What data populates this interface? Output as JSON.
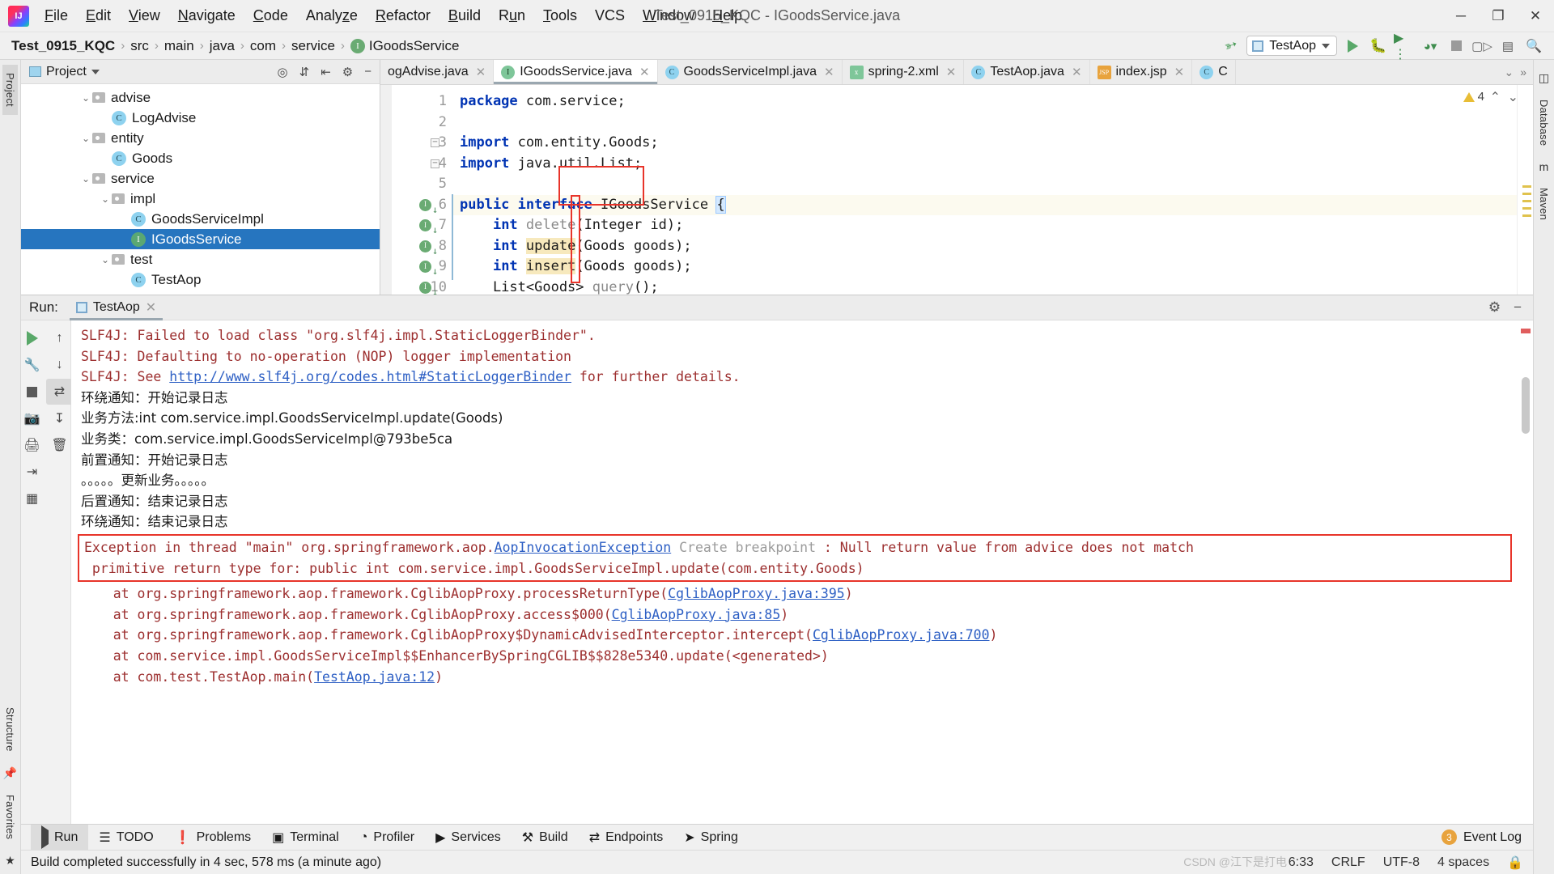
{
  "window": {
    "title": "Test_0915_KQC - IGoodsService.java",
    "minimize": "─",
    "maximize": "❐",
    "close": "✕"
  },
  "menu": [
    {
      "label": "File"
    },
    {
      "label": "Edit"
    },
    {
      "label": "View"
    },
    {
      "label": "Navigate"
    },
    {
      "label": "Code"
    },
    {
      "label": "Analyze"
    },
    {
      "label": "Refactor"
    },
    {
      "label": "Build"
    },
    {
      "label": "Run"
    },
    {
      "label": "Tools"
    },
    {
      "label": "VCS"
    },
    {
      "label": "Window"
    },
    {
      "label": "Help"
    }
  ],
  "breadcrumb": {
    "items": [
      "Test_0915_KQC",
      "src",
      "main",
      "java",
      "com",
      "service",
      "IGoodsService"
    ],
    "leaf_icon": "I",
    "separator": "›"
  },
  "toolbar": {
    "build_icon": "build-hammer-icon",
    "run_config": "TestAop",
    "run_label": "run-icon",
    "debug_label": "debug-icon",
    "coverage_label": "run-with-coverage-icon",
    "profiler_label": "profiler-icon",
    "stop_label": "stop-icon",
    "search_label": "search-icon"
  },
  "left_rail": [
    "Project",
    "Structure",
    "Favorites"
  ],
  "right_rail": [
    "Database",
    "Maven"
  ],
  "project_panel": {
    "title": "Project",
    "tools": [
      "locate-icon",
      "expand-all-icon",
      "collapse-all-icon",
      "settings-icon",
      "hide-icon"
    ],
    "tree": [
      {
        "label": "advise",
        "type": "folder",
        "indent": 3,
        "expanded": true
      },
      {
        "label": "LogAdvise",
        "type": "class",
        "indent": 4
      },
      {
        "label": "entity",
        "type": "folder",
        "indent": 3,
        "expanded": true
      },
      {
        "label": "Goods",
        "type": "class",
        "indent": 4
      },
      {
        "label": "service",
        "type": "folder",
        "indent": 3,
        "expanded": true
      },
      {
        "label": "impl",
        "type": "folder",
        "indent": 4,
        "expanded": true
      },
      {
        "label": "GoodsServiceImpl",
        "type": "class",
        "indent": 5
      },
      {
        "label": "IGoodsService",
        "type": "interface",
        "indent": 5,
        "selected": true
      },
      {
        "label": "test",
        "type": "folder",
        "indent": 4,
        "expanded": true
      },
      {
        "label": "TestAop",
        "type": "class",
        "indent": 5
      }
    ]
  },
  "editor": {
    "tabs": [
      {
        "label": "ogAdvise.java",
        "icon": "",
        "active": false,
        "closable": true
      },
      {
        "label": "IGoodsService.java",
        "icon": "I",
        "icon_kind": "green",
        "active": true,
        "closable": true
      },
      {
        "label": "GoodsServiceImpl.java",
        "icon": "C",
        "icon_kind": "blue",
        "active": false,
        "closable": true
      },
      {
        "label": "spring-2.xml",
        "icon": "x",
        "icon_kind": "xml",
        "active": false,
        "closable": true
      },
      {
        "label": "TestAop.java",
        "icon": "C",
        "icon_kind": "blue",
        "active": false,
        "closable": true
      },
      {
        "label": "index.jsp",
        "icon": "JSP",
        "icon_kind": "jsp",
        "active": false,
        "closable": true
      },
      {
        "label": "C",
        "icon": "C",
        "icon_kind": "blue",
        "active": false,
        "closable": false
      }
    ],
    "warning_count": "4",
    "lines": [
      {
        "n": "1",
        "segs": [
          {
            "t": "package ",
            "c": "kw"
          },
          {
            "t": "com.service;",
            "c": "pl"
          }
        ]
      },
      {
        "n": "2",
        "segs": []
      },
      {
        "n": "3",
        "fold": true,
        "segs": [
          {
            "t": "import ",
            "c": "kw"
          },
          {
            "t": "com.entity.Goods;",
            "c": "pl"
          }
        ]
      },
      {
        "n": "4",
        "fold": true,
        "segs": [
          {
            "t": "import ",
            "c": "kw"
          },
          {
            "t": "java.util.List;",
            "c": "pl"
          }
        ]
      },
      {
        "n": "5",
        "segs": []
      },
      {
        "n": "6",
        "marker": true,
        "hl": true,
        "segs": [
          {
            "t": "public ",
            "c": "kw"
          },
          {
            "t": "interface ",
            "c": "kw"
          },
          {
            "t": "IGoodsService ",
            "c": "pl"
          },
          {
            "t": "{",
            "c": "brace"
          }
        ]
      },
      {
        "n": "7",
        "marker": true,
        "segs": [
          {
            "t": "    ",
            "c": "pl"
          },
          {
            "t": "int ",
            "c": "kw"
          },
          {
            "t": "delete",
            "c": "mth"
          },
          {
            "t": "(Integer id);",
            "c": "pl"
          }
        ]
      },
      {
        "n": "8",
        "marker": true,
        "segs": [
          {
            "t": "    ",
            "c": "pl"
          },
          {
            "t": "int ",
            "c": "kw"
          },
          {
            "t": "update",
            "c": "hlident"
          },
          {
            "t": "(Goods goods);",
            "c": "pl"
          }
        ]
      },
      {
        "n": "9",
        "marker": true,
        "segs": [
          {
            "t": "    ",
            "c": "pl"
          },
          {
            "t": "int ",
            "c": "kw"
          },
          {
            "t": "insert",
            "c": "hlident"
          },
          {
            "t": "(Goods goods);",
            "c": "pl"
          }
        ]
      },
      {
        "n": "10",
        "marker": true,
        "segs": [
          {
            "t": "    List<Goods> ",
            "c": "pl"
          },
          {
            "t": "query",
            "c": "mth"
          },
          {
            "t": "();",
            "c": "pl"
          }
        ]
      }
    ]
  },
  "run_panel": {
    "label": "Run:",
    "tab": "TestAop",
    "close": "✕",
    "settings_icon": "gear-icon",
    "minimize_icon": "minimize-icon",
    "sidebar_buttons": [
      "rerun-icon",
      "up-stack-icon",
      "wrench-icon",
      "down-stack-icon",
      "stop-icon",
      "soft-wrap-icon",
      "camera-icon",
      "scroll-to-end-icon",
      "print-icon",
      "clear-all-icon",
      "trash-icon",
      "export-icon",
      "layout-icon",
      "pin-icon"
    ],
    "console": [
      {
        "kind": "err",
        "text": "SLF4J: Failed to load class \"org.slf4j.impl.StaticLoggerBinder\"."
      },
      {
        "kind": "err",
        "text": "SLF4J: Defaulting to no-operation (NOP) logger implementation"
      },
      {
        "kind": "err-link",
        "pre": "SLF4J: See ",
        "link": "http://www.slf4j.org/codes.html#StaticLoggerBinder",
        "post": " for further details."
      },
      {
        "kind": "cn",
        "text": "环绕通知：开始记录日志"
      },
      {
        "kind": "cn",
        "text": "业务方法:int com.service.impl.GoodsServiceImpl.update(Goods)"
      },
      {
        "kind": "cn",
        "text": "业务类：com.service.impl.GoodsServiceImpl@793be5ca"
      },
      {
        "kind": "cn",
        "text": "前置通知：开始记录日志"
      },
      {
        "kind": "cn",
        "text": "。。。。。更新业务。。。。。"
      },
      {
        "kind": "cn",
        "text": "后置通知：结束记录日志"
      },
      {
        "kind": "cn",
        "text": "环绕通知：结束记录日志"
      }
    ],
    "exception": {
      "line1_pre": "Exception in thread \"main\" org.springframework.aop.",
      "line1_link": "AopInvocationException",
      "line1_breakpoint": " Create breakpoint",
      "line1_post": " : Null return value from advice does not match",
      "line2": " primitive return type for: public int com.service.impl.GoodsServiceImpl.update(com.entity.Goods)"
    },
    "stack": [
      {
        "pre": "    at org.springframework.aop.framework.CglibAopProxy.processReturnType(",
        "link": "CglibAopProxy.java:395",
        "post": ")"
      },
      {
        "pre": "    at org.springframework.aop.framework.CglibAopProxy.access$000(",
        "link": "CglibAopProxy.java:85",
        "post": ")"
      },
      {
        "pre": "    at org.springframework.aop.framework.CglibAopProxy$DynamicAdvisedInterceptor.intercept(",
        "link": "CglibAopProxy.java:700",
        "post": ")"
      },
      {
        "pre": "    at com.service.impl.GoodsServiceImpl$$EnhancerBySpringCGLIB$$828e5340.update(<generated>)",
        "link": "",
        "post": ""
      },
      {
        "pre": "    at com.test.TestAop.main(",
        "link": "TestAop.java:12",
        "post": ")"
      }
    ]
  },
  "toolwindow_bar": {
    "items": [
      {
        "label": "Run",
        "icon": "play-icon",
        "selected": true
      },
      {
        "label": "TODO",
        "icon": "todo-icon"
      },
      {
        "label": "Problems",
        "icon": "problems-icon"
      },
      {
        "label": "Terminal",
        "icon": "terminal-icon"
      },
      {
        "label": "Profiler",
        "icon": "profiler-icon"
      },
      {
        "label": "Services",
        "icon": "services-icon"
      },
      {
        "label": "Build",
        "icon": "build-icon"
      },
      {
        "label": "Endpoints",
        "icon": "endpoints-icon"
      },
      {
        "label": "Spring",
        "icon": "spring-icon"
      }
    ],
    "event_log": "Event Log",
    "event_count": "3"
  },
  "statusbar": {
    "message": "Build completed successfully in 4 sec, 578 ms (a minute ago)",
    "caret": "6:33",
    "line_sep": "CRLF",
    "encoding": "UTF-8",
    "indent": "4 spaces",
    "watermark": "CSDN @江下是打电"
  }
}
